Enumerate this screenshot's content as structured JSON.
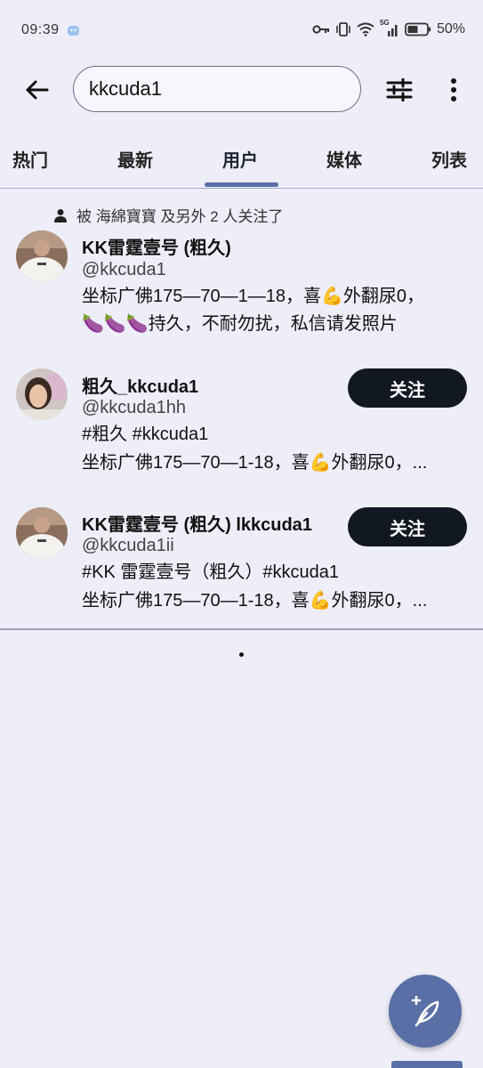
{
  "status_bar": {
    "time": "09:39",
    "battery_text": "50%",
    "network_label": "5G"
  },
  "search": {
    "value": "kkcuda1"
  },
  "tabs": [
    {
      "label": "热门"
    },
    {
      "label": "最新"
    },
    {
      "label": "用户"
    },
    {
      "label": "媒体"
    },
    {
      "label": "列表"
    }
  ],
  "active_tab": "用户",
  "results": {
    "followed_note": "被 海綿寶寶 及另外 2 人关注了",
    "users": [
      {
        "name": "KK雷霆壹号 (粗久)",
        "handle": "@kkcuda1",
        "bio_line1": "坐标广佛175—70—1—18，喜💪外翻尿0，",
        "bio_line2": "🍆🍆🍆持久，不耐勿扰，私信请发照片"
      },
      {
        "name": "粗久_kkcuda1",
        "handle": "@kkcuda1hh",
        "bio_line1": "#粗久 #kkcuda1",
        "bio_line2": "坐标广佛175—70—1-18，喜💪外翻尿0，...",
        "follow_label": "关注"
      },
      {
        "name": "KK雷霆壹号 (粗久) lkkcuda1",
        "handle": "@kkcuda1ii",
        "bio_line1": "#KK 雷霆壹号（粗久）#kkcuda1",
        "bio_line2": "坐标广佛175—70—1-18，喜💪外翻尿0，...",
        "follow_label": "关注"
      }
    ]
  },
  "colors": {
    "background": "#eeeef9",
    "accent": "#5a6fa6",
    "follow_button": "#121821"
  }
}
